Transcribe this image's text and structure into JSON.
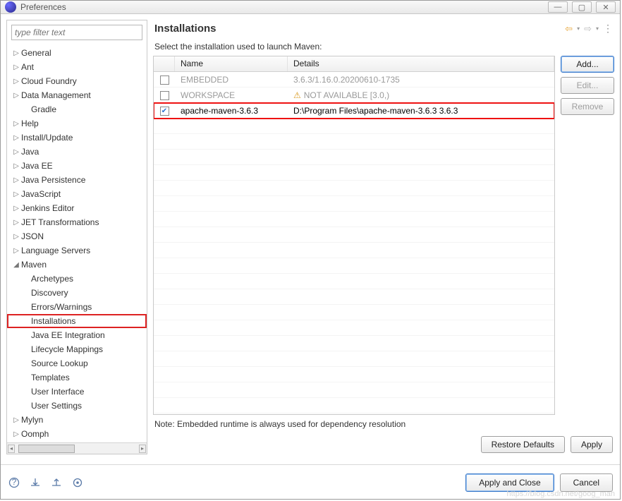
{
  "window": {
    "title": "Preferences"
  },
  "filter": {
    "placeholder": "type filter text"
  },
  "tree": [
    {
      "label": "General",
      "expandable": true,
      "expanded": false
    },
    {
      "label": "Ant",
      "expandable": true,
      "expanded": false
    },
    {
      "label": "Cloud Foundry",
      "expandable": true,
      "expanded": false
    },
    {
      "label": "Data Management",
      "expandable": true,
      "expanded": false
    },
    {
      "label": "Gradle",
      "expandable": false,
      "expanded": false,
      "child": true
    },
    {
      "label": "Help",
      "expandable": true,
      "expanded": false
    },
    {
      "label": "Install/Update",
      "expandable": true,
      "expanded": false
    },
    {
      "label": "Java",
      "expandable": true,
      "expanded": false
    },
    {
      "label": "Java EE",
      "expandable": true,
      "expanded": false
    },
    {
      "label": "Java Persistence",
      "expandable": true,
      "expanded": false
    },
    {
      "label": "JavaScript",
      "expandable": true,
      "expanded": false
    },
    {
      "label": "Jenkins Editor",
      "expandable": true,
      "expanded": false
    },
    {
      "label": "JET Transformations",
      "expandable": true,
      "expanded": false
    },
    {
      "label": "JSON",
      "expandable": true,
      "expanded": false
    },
    {
      "label": "Language Servers",
      "expandable": true,
      "expanded": false
    },
    {
      "label": "Maven",
      "expandable": true,
      "expanded": true
    },
    {
      "label": "Archetypes",
      "expandable": false,
      "child": true
    },
    {
      "label": "Discovery",
      "expandable": false,
      "child": true
    },
    {
      "label": "Errors/Warnings",
      "expandable": false,
      "child": true
    },
    {
      "label": "Installations",
      "expandable": false,
      "child": true,
      "selected": true
    },
    {
      "label": "Java EE Integration",
      "expandable": false,
      "child": true
    },
    {
      "label": "Lifecycle Mappings",
      "expandable": false,
      "child": true
    },
    {
      "label": "Source Lookup",
      "expandable": false,
      "child": true
    },
    {
      "label": "Templates",
      "expandable": false,
      "child": true
    },
    {
      "label": "User Interface",
      "expandable": false,
      "child": true
    },
    {
      "label": "User Settings",
      "expandable": false,
      "child": true
    },
    {
      "label": "Mylyn",
      "expandable": true,
      "expanded": false
    },
    {
      "label": "Oomph",
      "expandable": true,
      "expanded": false
    }
  ],
  "page": {
    "heading": "Installations",
    "description": "Select the installation used to launch Maven:",
    "columns": {
      "name": "Name",
      "details": "Details"
    },
    "rows": [
      {
        "checked": false,
        "name": "EMBEDDED",
        "details": "3.6.3/1.16.0.20200610-1735",
        "disabled": true
      },
      {
        "checked": false,
        "name": "WORKSPACE",
        "details": "NOT AVAILABLE [3.0,)",
        "disabled": true,
        "warn": true
      },
      {
        "checked": true,
        "name": "apache-maven-3.6.3",
        "details": "D:\\Program Files\\apache-maven-3.6.3 3.6.3",
        "highlight": true
      }
    ],
    "buttons": {
      "add": "Add...",
      "edit": "Edit...",
      "remove": "Remove"
    },
    "note": "Note: Embedded runtime is always used for dependency resolution",
    "restore": "Restore Defaults",
    "apply": "Apply"
  },
  "footer": {
    "apply_close": "Apply and Close",
    "cancel": "Cancel"
  },
  "watermark": "https://blog.csdn.net/goog_man"
}
